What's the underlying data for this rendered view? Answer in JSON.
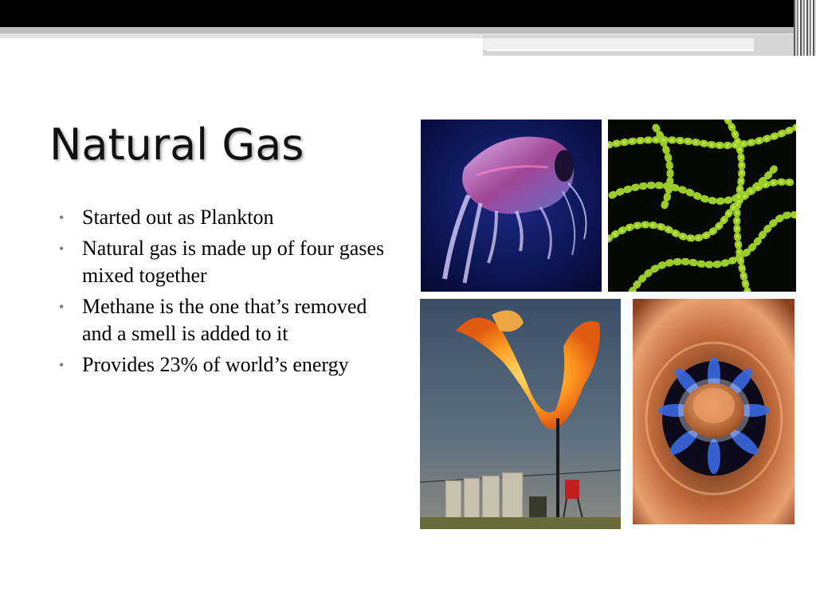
{
  "slide": {
    "title": "Natural Gas",
    "bullets": [
      "Started out as Plankton",
      "Natural gas is made up of four gases mixed together",
      "Methane is the one that’s removed and a smell is added to it",
      "Provides 23% of world’s energy"
    ],
    "bullet_glyph": "•"
  },
  "images": [
    {
      "name": "plankton-photo"
    },
    {
      "name": "algae-chain-photo"
    },
    {
      "name": "gas-flare-photo"
    },
    {
      "name": "gas-burner-photo"
    }
  ],
  "colors": {
    "top_band": "#000000",
    "bullet_marker": "#7a7a7a"
  }
}
